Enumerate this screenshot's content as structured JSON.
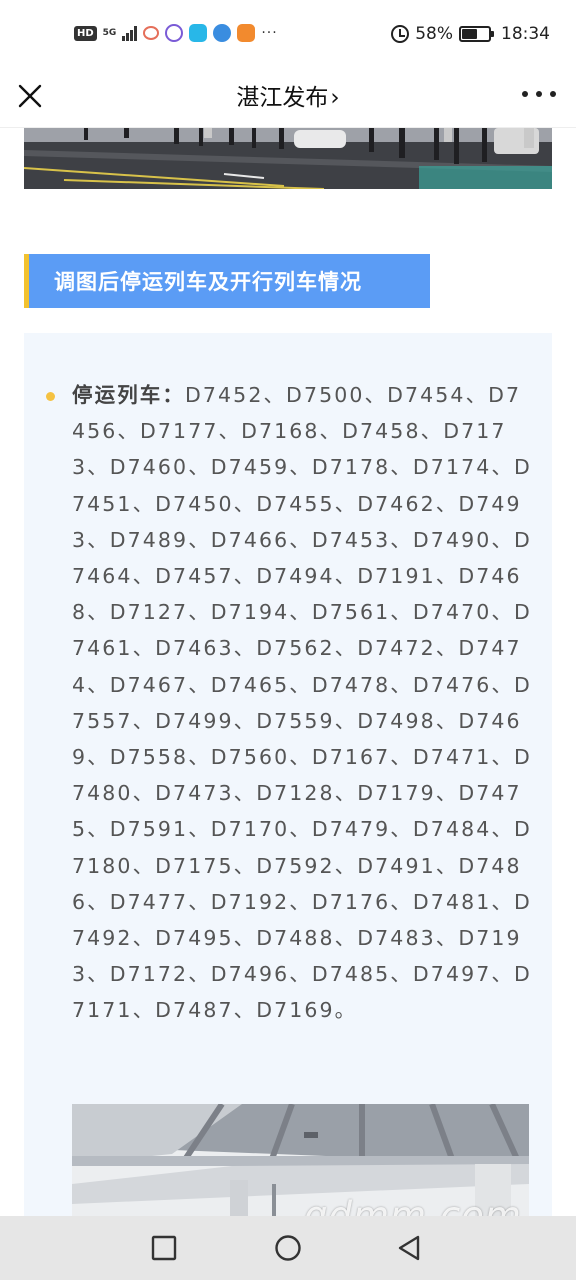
{
  "status_bar": {
    "network_badge": "HD",
    "network_type": "5G",
    "battery_percent": "58%",
    "battery_level": 0.58,
    "time": "18:34",
    "overflow_dots": "···"
  },
  "title_bar": {
    "title": "湛江发布",
    "chevron": "›",
    "close_icon": "close-icon",
    "more_icon": "more-icon"
  },
  "section": {
    "header": "调图后停运列车及开行列车情况",
    "accent_color": "#5b9cf5",
    "bar_color": "#f2c230"
  },
  "content": {
    "label": "停运列车：",
    "trains": "D7452、D7500、D7454、D7456、D7177、D7168、D7458、D7173、D7460、D7459、D7178、D7174、D7451、D7450、D7455、D7462、D7493、D7489、D7466、D7453、D7490、D7464、D7457、D7494、D7191、D7468、D7127、D7194、D7561、D7470、D7461、D7463、D7562、D7472、D7474、D7467、D7465、D7478、D7476、D7557、D7499、D7559、D7498、D7469、D7558、D7560、D7167、D7471、D7480、D7473、D7128、D7179、D7475、D7591、D7170、D7479、D7484、D7180、D7175、D7592、D7491、D7486、D7477、D7192、D7176、D7481、D7492、D7495、D7488、D7483、D7193、D7172、D7496、D7485、D7497、D7171、D7487、D7169。"
  },
  "watermark": "gdmm.com",
  "nav_bar": {
    "recent_icon": "square-icon",
    "home_icon": "circle-icon",
    "back_icon": "triangle-back-icon"
  }
}
